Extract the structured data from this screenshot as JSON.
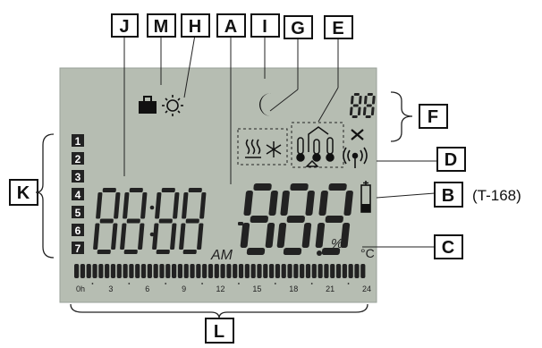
{
  "callouts": {
    "J": "J",
    "M": "M",
    "H": "H",
    "A": "A",
    "I": "I",
    "G": "G",
    "E": "E",
    "F": "F",
    "D": "D",
    "B": "B",
    "C": "C",
    "K": "K",
    "L": "L"
  },
  "model": "(T-168)",
  "display": {
    "clock_digits": "8888",
    "am_label": "AM",
    "temp_digits": "-888",
    "percent": "%",
    "celsius": "°C",
    "small_digits": "88",
    "days": [
      "1",
      "2",
      "3",
      "4",
      "5",
      "6",
      "7"
    ],
    "timeline_ticks": [
      "0h",
      "3",
      "6",
      "9",
      "12",
      "15",
      "18",
      "21",
      "24"
    ]
  },
  "icons": [
    "suitcase-icon",
    "sun-icon",
    "moon-icon",
    "heating-icon",
    "snowflake-icon",
    "thermometer-icon",
    "wrench-icon",
    "antenna-icon",
    "battery-icon"
  ],
  "colors": {
    "lcd_background": "#b6bdb2",
    "segment": "#222222",
    "callout_border": "#111111"
  }
}
